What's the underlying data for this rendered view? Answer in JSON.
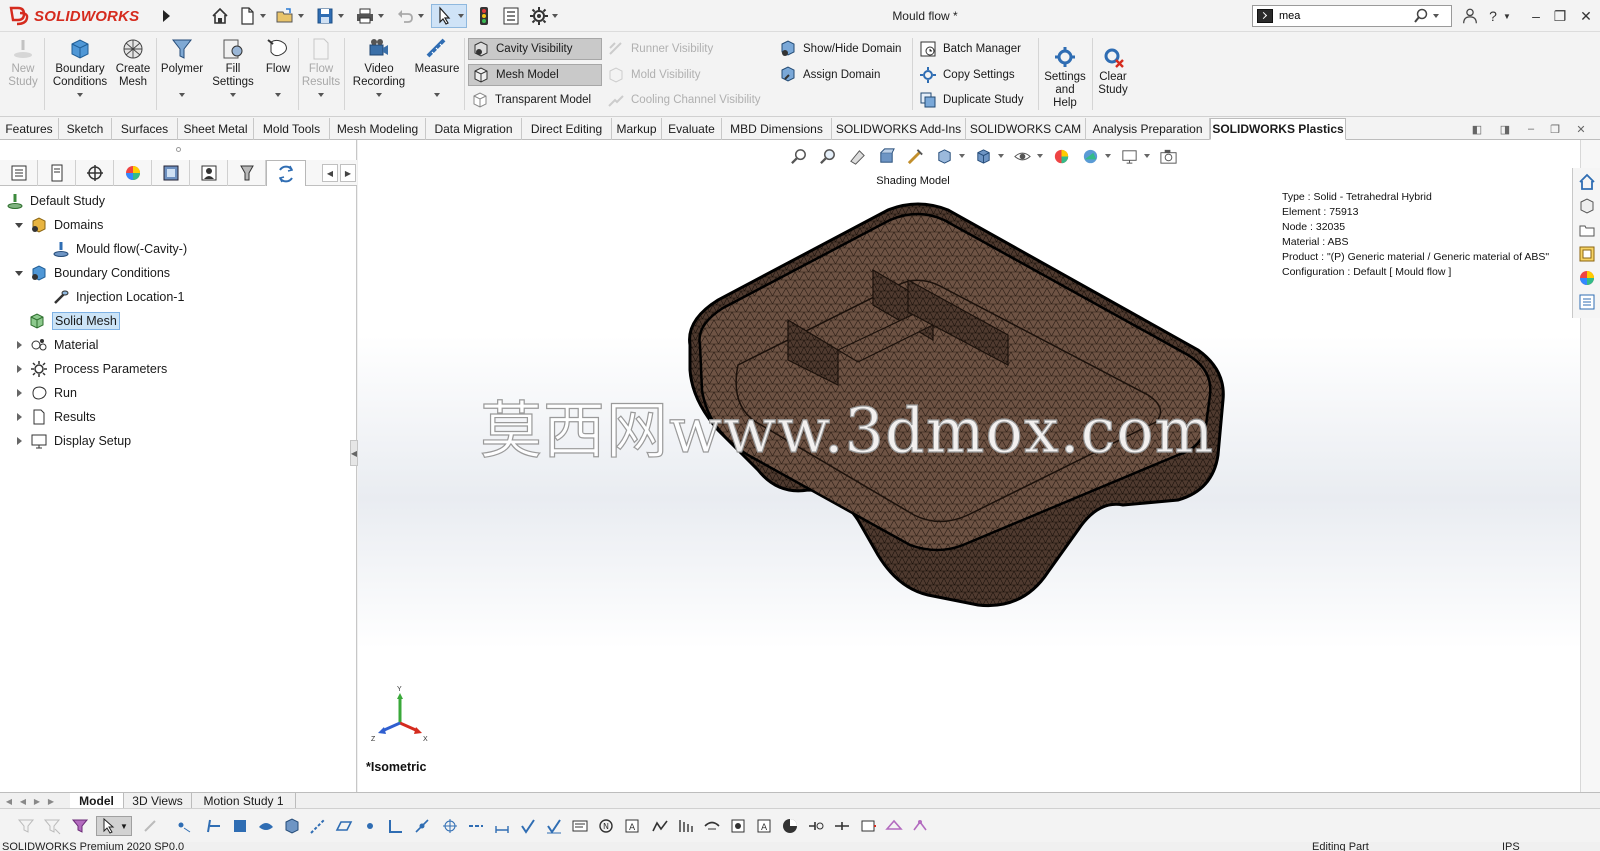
{
  "app": {
    "brand": "SOLIDWORKS",
    "document_title": "Mould flow *"
  },
  "search": {
    "value": "mea"
  },
  "ribbon": {
    "new_study": "New Study",
    "boundary_conditions": "Boundary Conditions",
    "create_mesh": "Create Mesh",
    "polymer": "Polymer",
    "fill_settings": "Fill Settings",
    "flow": "Flow",
    "flow_results": "Flow Results",
    "video_recording": "Video Recording",
    "measure": "Measure",
    "cavity_visibility": "Cavity Visibility",
    "mesh_model": "Mesh Model",
    "transparent_model": "Transparent Model",
    "runner_visibility": "Runner Visibility",
    "mold_visibility": "Mold Visibility",
    "cooling_channel_visibility": "Cooling Channel Visibility",
    "show_hide_domain": "Show/Hide Domain",
    "assign_domain": "Assign Domain",
    "batch_manager": "Batch Manager",
    "copy_settings": "Copy Settings",
    "duplicate_study": "Duplicate Study",
    "settings_and_help": "Settings and Help",
    "clear_study": "Clear Study"
  },
  "cm_tabs": [
    "Features",
    "Sketch",
    "Surfaces",
    "Sheet Metal",
    "Mold Tools",
    "Mesh Modeling",
    "Data Migration",
    "Direct Editing",
    "Markup",
    "Evaluate",
    "MBD Dimensions",
    "SOLIDWORKS Add-Ins",
    "SOLIDWORKS CAM",
    "Analysis Preparation",
    "SOLIDWORKS Plastics"
  ],
  "tree": {
    "default_study": "Default Study",
    "domains": "Domains",
    "mould_flow_cavity": "Mould flow(-Cavity-)",
    "boundary_conditions": "Boundary Conditions",
    "injection_location": "Injection Location-1",
    "solid_mesh": "Solid Mesh",
    "material": "Material",
    "process_parameters": "Process Parameters",
    "run": "Run",
    "results": "Results",
    "display_setup": "Display Setup"
  },
  "viewport": {
    "shading_label": "Shading Model",
    "view_name": "*Isometric",
    "watermark": "莫西网www.3dmox.com",
    "mesh_info": [
      "Type : Solid - Tetrahedral Hybrid",
      "Element : 75913",
      "Node : 32035",
      "Material : ABS",
      "Product :   \"(P)  Generic material / Generic material of ABS\"",
      "Configuration : Default [ Mould flow ]"
    ],
    "triad": {
      "x": "X",
      "y": "Y",
      "z": "Z"
    }
  },
  "bottom_tabs": [
    "Model",
    "3D Views",
    "Motion Study 1"
  ],
  "statusbar": {
    "left": "SOLIDWORKS Premium 2020 SP0.0",
    "mid": "Editing Part",
    "right": "IPS"
  },
  "colors": {
    "brand_red": "#d52b1e",
    "mesh_fill": "#6e5344",
    "mesh_line": "#2a1c14",
    "selection_blue": "#cce4f7"
  }
}
